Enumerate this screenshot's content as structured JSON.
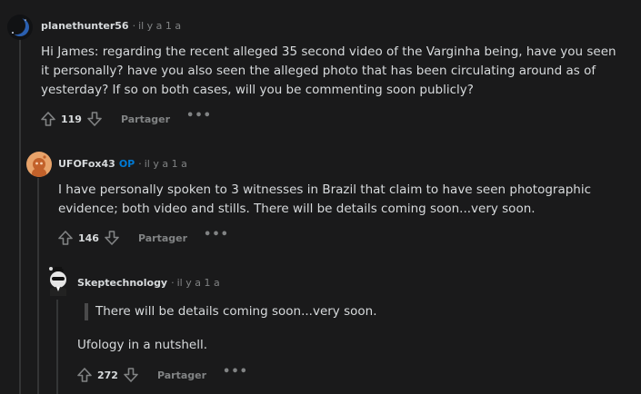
{
  "comments": [
    {
      "username": "planethunter56",
      "time": "il y a 1 a",
      "body": "Hi James: regarding the recent alleged 35 second video of the Varginha being, have you seen it personally? have you also seen the alleged photo that has been circulating around as of yesterday? If so on both cases, will you be commenting soon publicly?",
      "score": "119",
      "share_label": "Partager",
      "more_label": "•••",
      "avatar_icon": "moon-avatar-icon"
    },
    {
      "username": "UFOFox43",
      "op_badge": "OP",
      "time": "il y a 1 a",
      "body": "I have personally spoken to 3 witnesses in Brazil that claim to have seen photographic evidence; both video and stills. There will be details coming soon...very soon.",
      "score": "146",
      "share_label": "Partager",
      "more_label": "•••",
      "avatar_icon": "snoo-orange-avatar-icon"
    },
    {
      "username": "Skeptechnology",
      "time": "il y a 1 a",
      "quote": "There will be details coming soon...very soon.",
      "body": "Ufology in a nutshell.",
      "score": "272",
      "share_label": "Partager",
      "more_label": "•••",
      "avatar_icon": "snoo-tuxedo-avatar-icon"
    }
  ],
  "separator": "·",
  "colors": {
    "background": "#1a1a1b",
    "text": "#d7dadc",
    "muted": "#818384",
    "op": "#0079d3",
    "thread_line": "#343536"
  }
}
